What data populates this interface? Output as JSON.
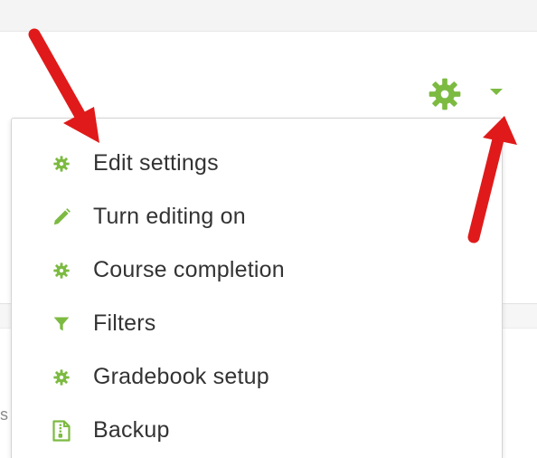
{
  "colors": {
    "accent": "#7cba41",
    "arrow": "#e01a1a",
    "text": "#333333"
  },
  "trigger": {
    "icon": "gear-icon",
    "caret_icon": "caret-down-icon"
  },
  "menu": {
    "items": [
      {
        "label": "Edit settings",
        "icon": "gear-icon"
      },
      {
        "label": "Turn editing on",
        "icon": "pencil-icon"
      },
      {
        "label": "Course completion",
        "icon": "gear-icon"
      },
      {
        "label": "Filters",
        "icon": "filter-icon"
      },
      {
        "label": "Gradebook setup",
        "icon": "gear-icon"
      },
      {
        "label": "Backup",
        "icon": "backup-file-icon"
      }
    ]
  },
  "background": {
    "partial_char": "s"
  }
}
